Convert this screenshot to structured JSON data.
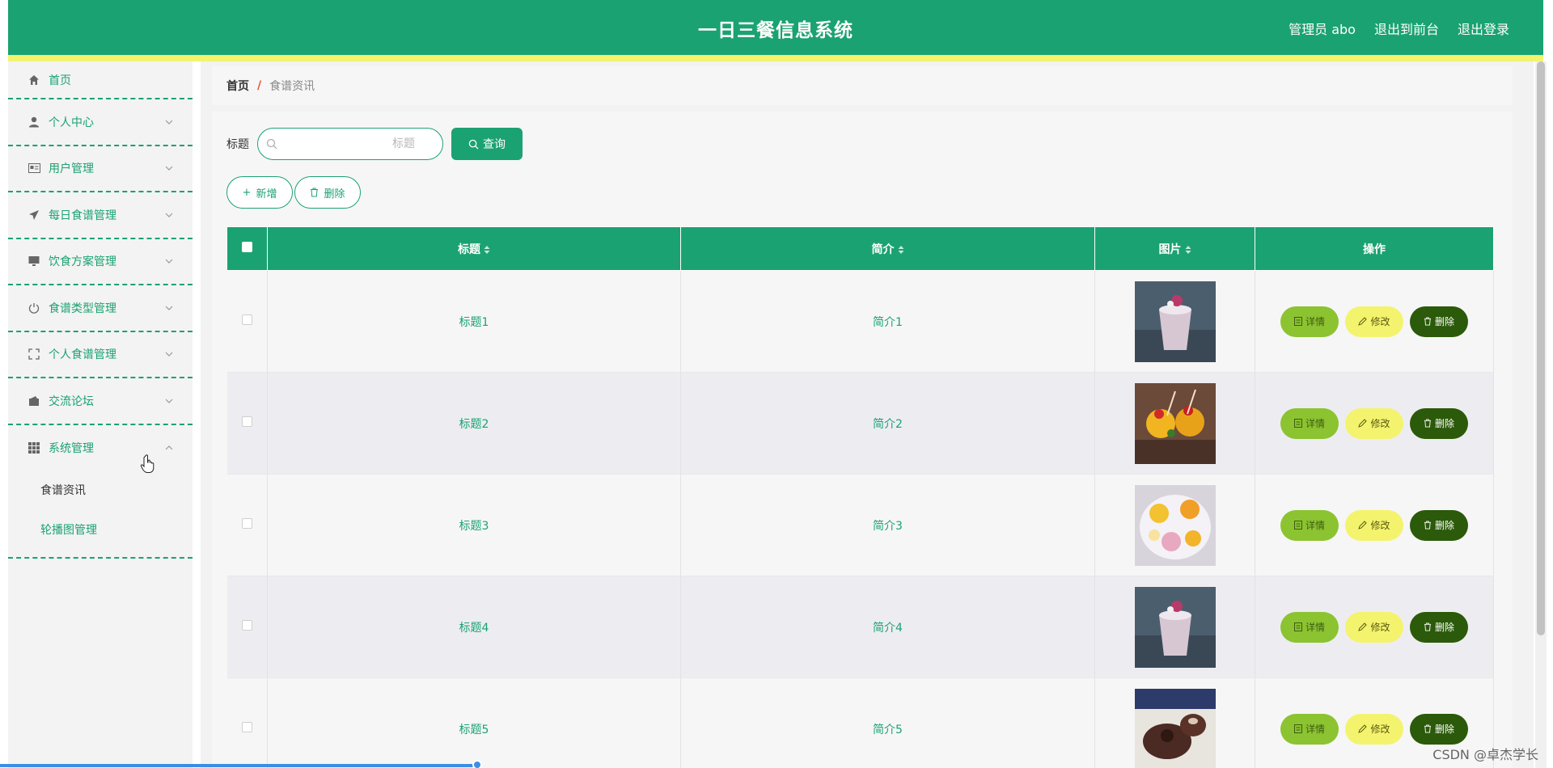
{
  "header": {
    "title": "一日三餐信息系统",
    "admin": "管理员 abo",
    "back_front": "退出到前台",
    "logout": "退出登录"
  },
  "sidebar": {
    "items": [
      {
        "label": "首页",
        "icon": "home-icon"
      },
      {
        "label": "个人中心",
        "icon": "user-icon"
      },
      {
        "label": "用户管理",
        "icon": "id-card-icon"
      },
      {
        "label": "每日食谱管理",
        "icon": "paper-plane-icon"
      },
      {
        "label": "饮食方案管理",
        "icon": "monitor-icon"
      },
      {
        "label": "食谱类型管理",
        "icon": "power-icon"
      },
      {
        "label": "个人食谱管理",
        "icon": "fullscreen-icon"
      },
      {
        "label": "交流论坛",
        "icon": "wallet-icon"
      },
      {
        "label": "系统管理",
        "icon": "grid-icon"
      }
    ],
    "submenu": [
      "食谱资讯",
      "轮播图管理"
    ]
  },
  "breadcrumb": {
    "home": "首页",
    "separator": "/",
    "current": "食谱资讯"
  },
  "search": {
    "label": "标题",
    "placeholder": "标题",
    "button": "查询"
  },
  "actions": {
    "add": "新增",
    "delete": "删除"
  },
  "table": {
    "headers": [
      "标题",
      "简介",
      "图片",
      "操作"
    ],
    "rows": [
      {
        "title": "标题1",
        "intro": "简介1"
      },
      {
        "title": "标题2",
        "intro": "简介2"
      },
      {
        "title": "标题3",
        "intro": "简介3"
      },
      {
        "title": "标题4",
        "intro": "简介4"
      },
      {
        "title": "标题5",
        "intro": "简介5"
      }
    ],
    "ops": {
      "detail": "详情",
      "edit": "修改",
      "remove": "删除"
    }
  },
  "watermark": "CSDN @卓杰学长",
  "colors": {
    "primary": "#1ba272",
    "stripe": "#f4f36e",
    "detail": "#8cc331",
    "remove": "#2b5a0a"
  }
}
